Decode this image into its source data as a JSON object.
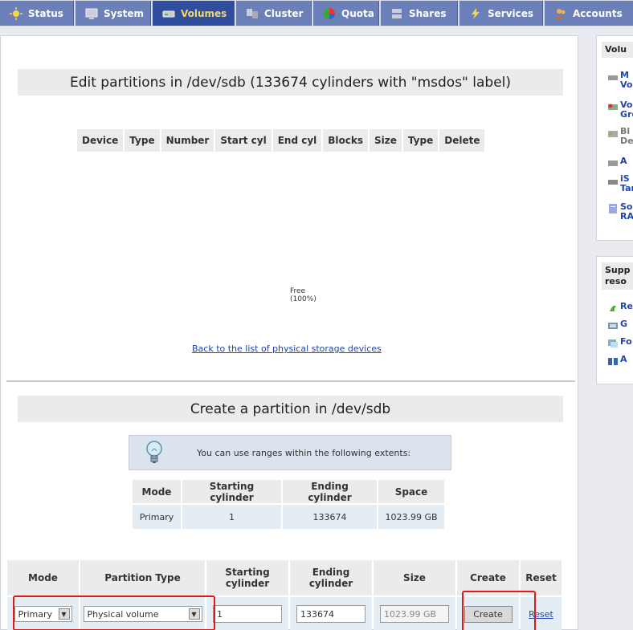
{
  "nav": {
    "tabs": [
      {
        "label": "Status",
        "icon": "sun-icon"
      },
      {
        "label": "System",
        "icon": "monitor-icon"
      },
      {
        "label": "Volumes",
        "icon": "disk-icon"
      },
      {
        "label": "Cluster",
        "icon": "cluster-icon"
      },
      {
        "label": "Quota",
        "icon": "pie-icon"
      },
      {
        "label": "Shares",
        "icon": "server-icon"
      },
      {
        "label": "Services",
        "icon": "lightning-icon"
      },
      {
        "label": "Accounts",
        "icon": "users-icon"
      }
    ],
    "active_tab": "Volumes"
  },
  "partitions": {
    "title": "Edit partitions in /dev/sdb (133674 cylinders with \"msdos\" label)",
    "columns": [
      "Device",
      "Type",
      "Number",
      "Start cyl",
      "End cyl",
      "Blocks",
      "Size",
      "Type",
      "Delete"
    ],
    "free_label": "Free",
    "free_percent": "(100%)",
    "back_link": "Back to the list of physical storage devices"
  },
  "create": {
    "title": "Create a partition in /dev/sdb",
    "info_text": "You can use ranges within the following extents:",
    "extents": {
      "columns": [
        "Mode",
        "Starting cylinder",
        "Ending cylinder",
        "Space"
      ],
      "row": [
        "Primary",
        "1",
        "133674",
        "1023.99 GB"
      ]
    },
    "form": {
      "columns": [
        "Mode",
        "Partition Type",
        "Starting cylinder",
        "Ending cylinder",
        "Size",
        "Create",
        "Reset"
      ],
      "mode_value": "Primary",
      "type_value": "Physical volume",
      "start_value": "1",
      "end_value": "133674",
      "size_value": "1023.99 GB",
      "create_label": "Create",
      "reset_label": "Reset"
    }
  },
  "side": {
    "volumes_header": "Volu",
    "volume_items": [
      {
        "line1": "M",
        "line2": "Volu",
        "icon": "disk-icon"
      },
      {
        "line1": "Vo",
        "line2": "Grou",
        "icon": "volume-group-icon"
      },
      {
        "line1": "Bl",
        "line2": "Devi",
        "icon": "block-device-icon"
      },
      {
        "line1": "A",
        "line2": "",
        "icon": "drive-icon"
      },
      {
        "line1": "iS",
        "line2": "Targ",
        "icon": "iscsi-icon"
      },
      {
        "line1": "So",
        "line2": "RAID",
        "icon": "raid-icon"
      }
    ],
    "support_header_1": "Supp",
    "support_header_2": "reso",
    "support_items": [
      {
        "line1": "Re",
        "icon": "gecko-icon"
      },
      {
        "line1": "G",
        "icon": "guide-icon"
      },
      {
        "line1": "Fo",
        "icon": "forum-icon"
      },
      {
        "line1": "A",
        "icon": "book-icon"
      }
    ]
  }
}
